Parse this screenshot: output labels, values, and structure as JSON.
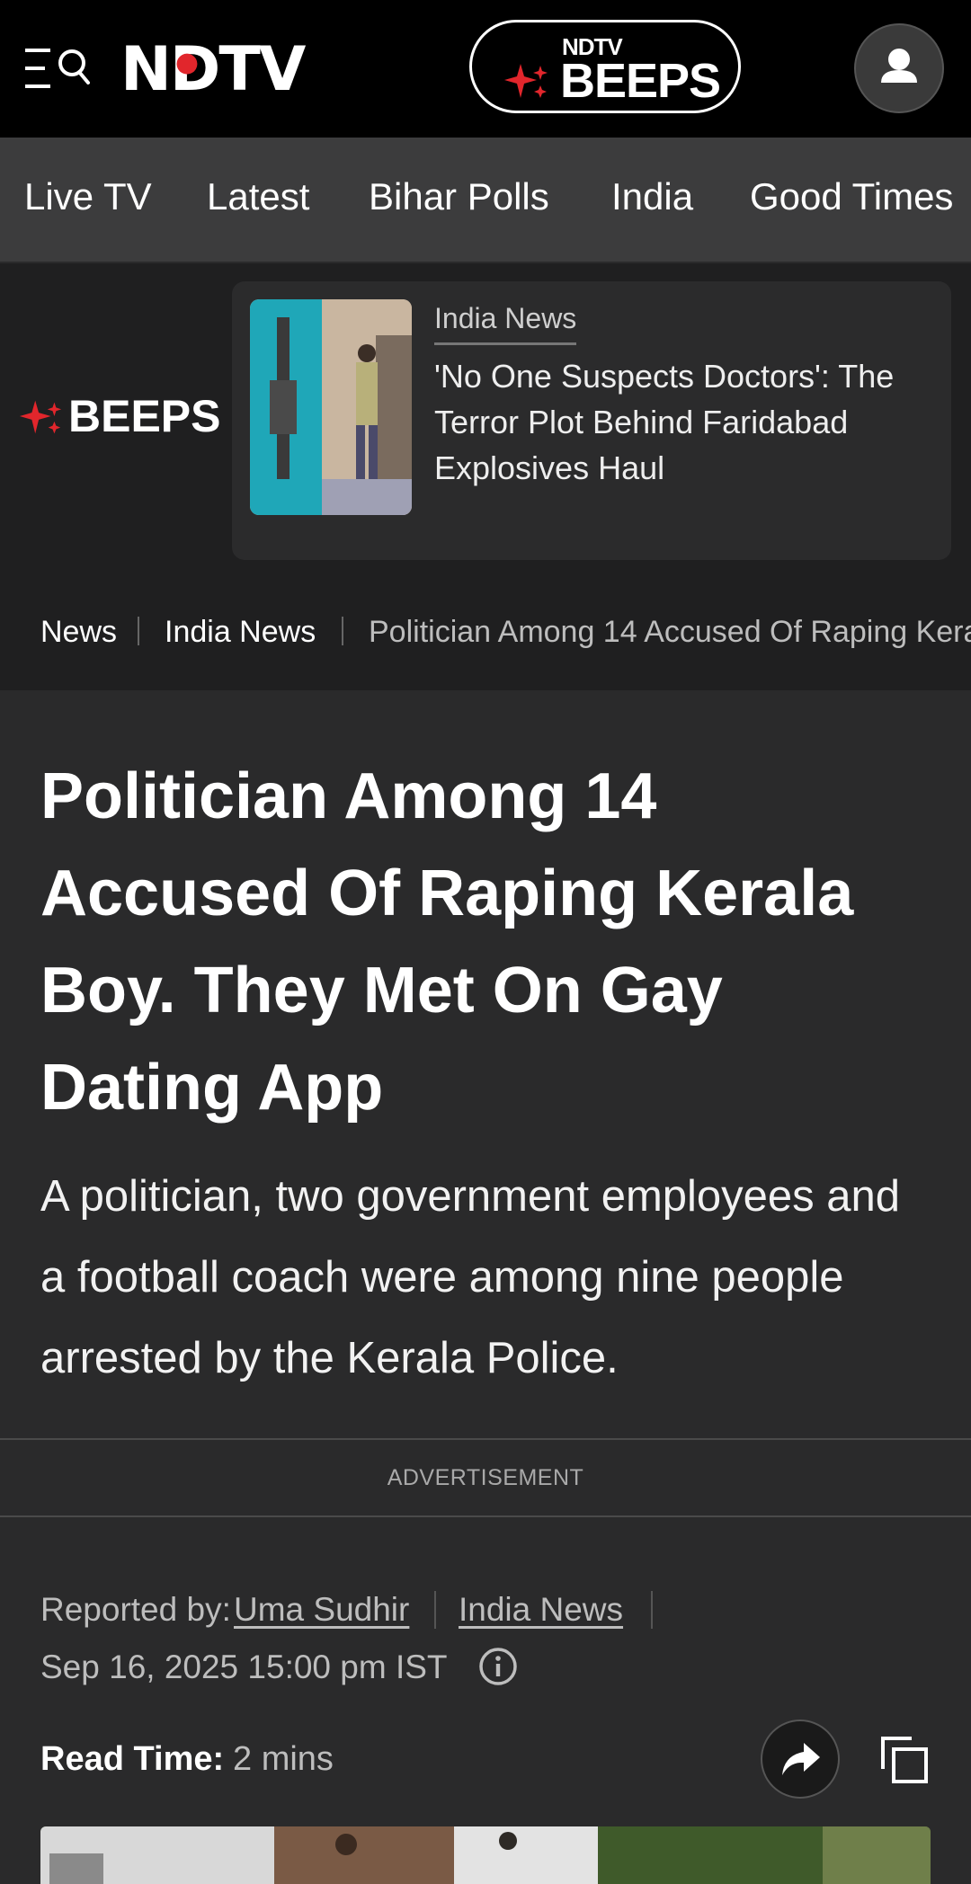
{
  "header": {
    "logo_text": "NDTV",
    "beeps_small": "NDTV",
    "beeps_word": "BEEPS"
  },
  "nav": {
    "tabs": [
      "Live TV",
      "Latest",
      "Bihar Polls",
      "India",
      "Good Times"
    ]
  },
  "beeps_strip": {
    "logo_word": "BEEPS",
    "card": {
      "category": "India News",
      "title": "'No One Suspects Doctors': The Terror Plot Behind Faridabad Explosives Haul"
    }
  },
  "breadcrumb": [
    "News",
    "India News",
    "Politician Among 14 Accused Of Raping Kerala Boy. They Met On Gay Dating App"
  ],
  "article": {
    "headline": "Politician Among 14 Accused Of Raping Kerala Boy. They Met On Gay Dating App",
    "summary": "A politician, two government employees and a football coach were among nine people arrested by the Kerala Police.",
    "ad_label": "ADVERTISEMENT",
    "reported_by_label": "Reported by:",
    "author": "Uma Sudhir",
    "category": "India News",
    "date": "Sep 16, 2025 15:00 pm IST",
    "read_time_label": "Read Time:",
    "read_time_value": "2 mins"
  },
  "colors": {
    "brand_red": "#e1262c",
    "header_bg": "#000000",
    "nav_bg": "#3c3c3d",
    "page_bg": "#2a2a2b"
  },
  "icons": [
    "menu-search-icon",
    "spark-icon",
    "user-icon",
    "info-icon",
    "share-icon",
    "copy-icon"
  ]
}
